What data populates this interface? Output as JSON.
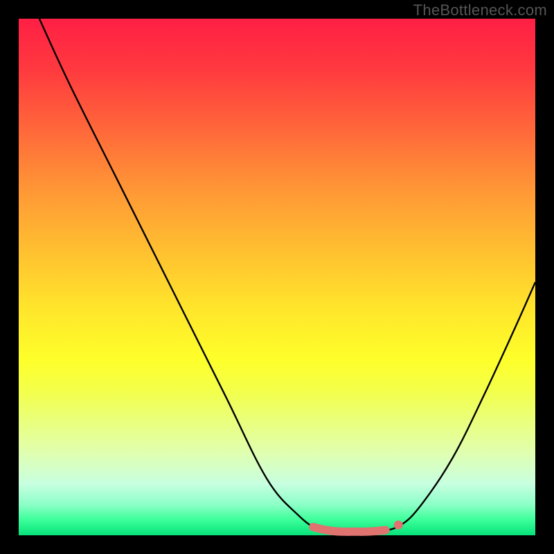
{
  "watermark": "TheBottleneck.com",
  "chart_data": {
    "type": "line",
    "title": "",
    "xlabel": "",
    "ylabel": "",
    "xlim": [
      0,
      100
    ],
    "ylim": [
      0,
      100
    ],
    "grid": false,
    "legend": false,
    "series": [
      {
        "name": "bottleneck-curve",
        "color": "#000000",
        "points": [
          {
            "x": 4,
            "y": 100
          },
          {
            "x": 10,
            "y": 87
          },
          {
            "x": 20,
            "y": 67
          },
          {
            "x": 30,
            "y": 47
          },
          {
            "x": 40,
            "y": 27
          },
          {
            "x": 48,
            "y": 11
          },
          {
            "x": 54,
            "y": 4
          },
          {
            "x": 58,
            "y": 1.2
          },
          {
            "x": 62,
            "y": 0.6
          },
          {
            "x": 66,
            "y": 0.6
          },
          {
            "x": 70,
            "y": 0.8
          },
          {
            "x": 74,
            "y": 2
          },
          {
            "x": 78,
            "y": 6
          },
          {
            "x": 84,
            "y": 15
          },
          {
            "x": 90,
            "y": 27
          },
          {
            "x": 96,
            "y": 40
          },
          {
            "x": 100,
            "y": 49
          }
        ]
      }
    ],
    "highlight": {
      "name": "optimal-range",
      "color": "#e0736f",
      "points": [
        {
          "x": 57,
          "y": 1.6
        },
        {
          "x": 59,
          "y": 1.1
        },
        {
          "x": 61,
          "y": 0.8
        },
        {
          "x": 63,
          "y": 0.7
        },
        {
          "x": 65,
          "y": 0.7
        },
        {
          "x": 67,
          "y": 0.7
        },
        {
          "x": 69,
          "y": 0.8
        },
        {
          "x": 71,
          "y": 1.0
        }
      ],
      "marker": {
        "x": 73.5,
        "y": 2.0
      }
    }
  }
}
